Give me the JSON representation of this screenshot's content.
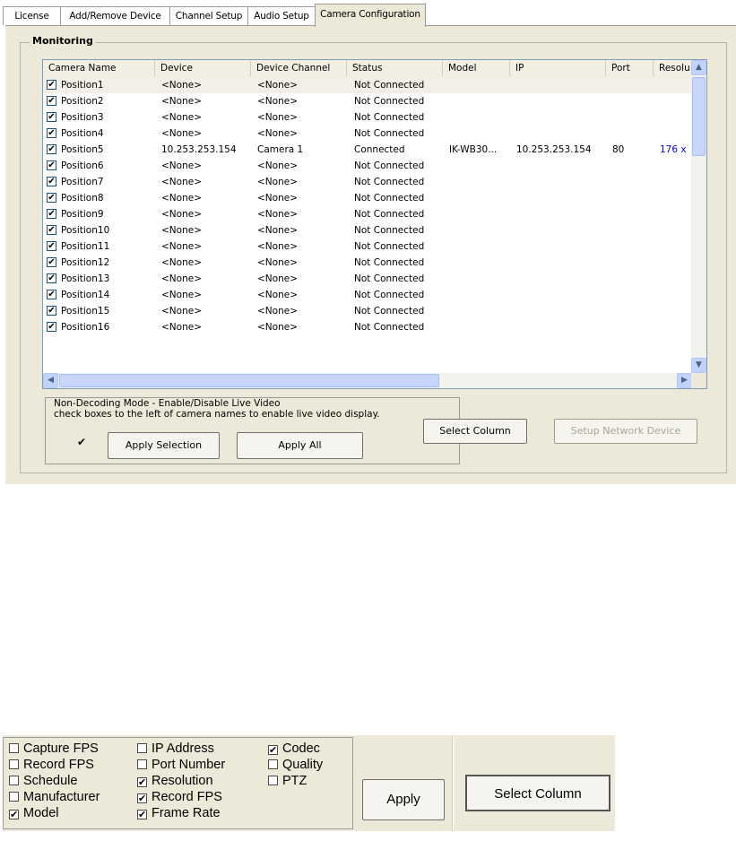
{
  "tabs": [
    {
      "label": "License"
    },
    {
      "label": "Add/Remove Device"
    },
    {
      "label": "Channel Setup"
    },
    {
      "label": "Audio Setup"
    },
    {
      "label": "Camera Configuration"
    }
  ],
  "monitoring": {
    "title": "Monitoring",
    "columns": [
      "Camera Name",
      "Device",
      "Device Channel",
      "Status",
      "Model",
      "IP",
      "Port",
      "Resolu"
    ],
    "rows": [
      {
        "name": "Position1",
        "device": "<None>",
        "channel": "<None>",
        "status": "Not Connected",
        "model": "",
        "ip": "",
        "port": "",
        "res": "",
        "checked": true
      },
      {
        "name": "Position2",
        "device": "<None>",
        "channel": "<None>",
        "status": "Not Connected",
        "model": "",
        "ip": "",
        "port": "",
        "res": "",
        "checked": true
      },
      {
        "name": "Position3",
        "device": "<None>",
        "channel": "<None>",
        "status": "Not Connected",
        "model": "",
        "ip": "",
        "port": "",
        "res": "",
        "checked": true
      },
      {
        "name": "Position4",
        "device": "<None>",
        "channel": "<None>",
        "status": "Not Connected",
        "model": "",
        "ip": "",
        "port": "",
        "res": "",
        "checked": true
      },
      {
        "name": "Position5",
        "device": "10.253.253.154",
        "channel": "Camera 1",
        "status": "Connected",
        "model": "IK-WB30...",
        "ip": "10.253.253.154",
        "port": "80",
        "res": "176 x",
        "checked": true
      },
      {
        "name": "Position6",
        "device": "<None>",
        "channel": "<None>",
        "status": "Not Connected",
        "model": "",
        "ip": "",
        "port": "",
        "res": "",
        "checked": true
      },
      {
        "name": "Position7",
        "device": "<None>",
        "channel": "<None>",
        "status": "Not Connected",
        "model": "",
        "ip": "",
        "port": "",
        "res": "",
        "checked": true
      },
      {
        "name": "Position8",
        "device": "<None>",
        "channel": "<None>",
        "status": "Not Connected",
        "model": "",
        "ip": "",
        "port": "",
        "res": "",
        "checked": true
      },
      {
        "name": "Position9",
        "device": "<None>",
        "channel": "<None>",
        "status": "Not Connected",
        "model": "",
        "ip": "",
        "port": "",
        "res": "",
        "checked": true
      },
      {
        "name": "Position10",
        "device": "<None>",
        "channel": "<None>",
        "status": "Not Connected",
        "model": "",
        "ip": "",
        "port": "",
        "res": "",
        "checked": true
      },
      {
        "name": "Position11",
        "device": "<None>",
        "channel": "<None>",
        "status": "Not Connected",
        "model": "",
        "ip": "",
        "port": "",
        "res": "",
        "checked": true
      },
      {
        "name": "Position12",
        "device": "<None>",
        "channel": "<None>",
        "status": "Not Connected",
        "model": "",
        "ip": "",
        "port": "",
        "res": "",
        "checked": true
      },
      {
        "name": "Position13",
        "device": "<None>",
        "channel": "<None>",
        "status": "Not Connected",
        "model": "",
        "ip": "",
        "port": "",
        "res": "",
        "checked": true
      },
      {
        "name": "Position14",
        "device": "<None>",
        "channel": "<None>",
        "status": "Not Connected",
        "model": "",
        "ip": "",
        "port": "",
        "res": "",
        "checked": true
      },
      {
        "name": "Position15",
        "device": "<None>",
        "channel": "<None>",
        "status": "Not Connected",
        "model": "",
        "ip": "",
        "port": "",
        "res": "",
        "checked": true
      },
      {
        "name": "Position16",
        "device": "<None>",
        "channel": "<None>",
        "status": "Not Connected",
        "model": "",
        "ip": "",
        "port": "",
        "res": "",
        "checked": true
      }
    ]
  },
  "non_decoding": {
    "line1": "Non-Decoding Mode - Enable/Disable Live Video",
    "line2": "check boxes to the left of camera names to enable live video display.",
    "checked": true,
    "apply_selection": "Apply Selection",
    "apply_all": "Apply All"
  },
  "buttons": {
    "select_column": "Select Column",
    "setup_network_device": "Setup Network Device"
  },
  "column_picker": {
    "options": [
      {
        "label": "Capture FPS",
        "checked": false
      },
      {
        "label": "Record FPS",
        "checked": false
      },
      {
        "label": "Schedule",
        "checked": false
      },
      {
        "label": "Manufacturer",
        "checked": false
      },
      {
        "label": "Model",
        "checked": true
      },
      {
        "label": "IP Address",
        "checked": false
      },
      {
        "label": "Port Number",
        "checked": false
      },
      {
        "label": "Resolution",
        "checked": true
      },
      {
        "label": "Record FPS",
        "checked": true
      },
      {
        "label": "Frame Rate",
        "checked": true
      },
      {
        "label": "Codec",
        "checked": true
      },
      {
        "label": "Quality",
        "checked": false
      },
      {
        "label": "PTZ",
        "checked": false
      }
    ],
    "apply": "Apply",
    "select_column": "Select Column"
  },
  "colors": {
    "dialog_bg": "#ece9d8",
    "link_blue": "#0000ff",
    "scrollbar": "#c1d3fb"
  },
  "icons": {
    "scroll_up": "▲",
    "scroll_down": "▼",
    "scroll_left": "◀",
    "scroll_right": "▶",
    "check": "✔"
  }
}
